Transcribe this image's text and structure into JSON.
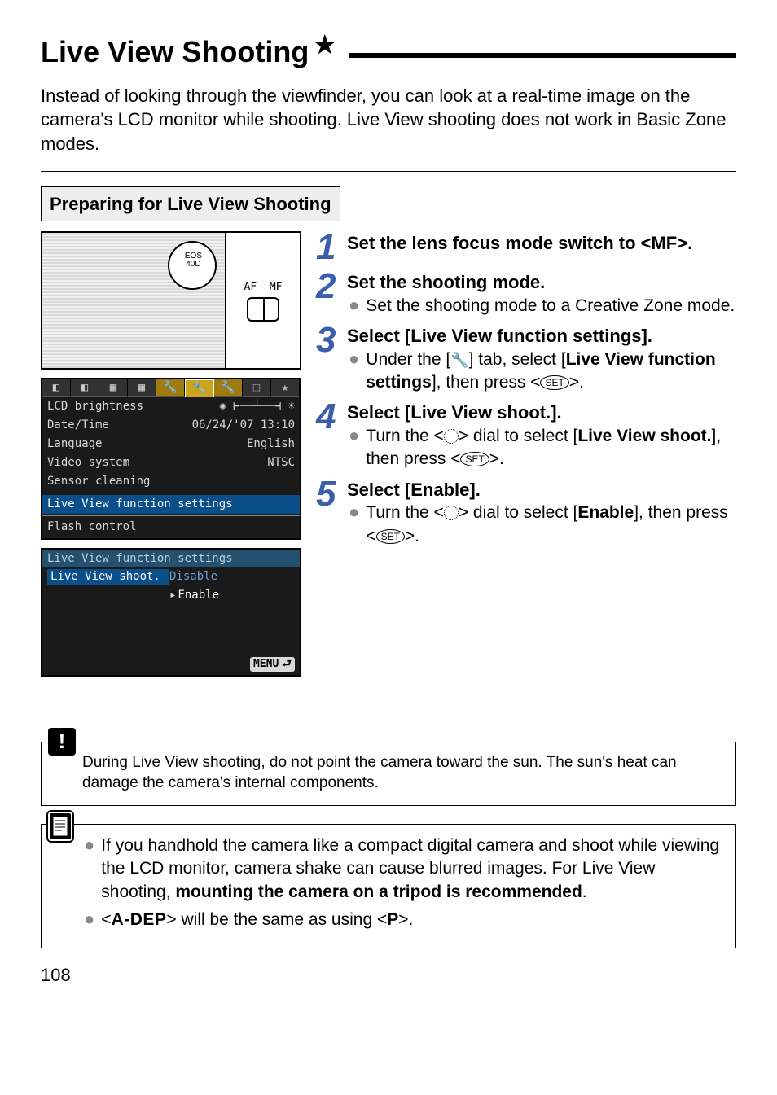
{
  "title": "Live View Shooting",
  "title_star": "★",
  "intro": "Instead of looking through the viewfinder, you can look at a real-time image on the camera's LCD monitor while shooting. Live View shooting does not work in Basic Zone modes.",
  "section_heading": "Preparing for Live View Shooting",
  "camera": {
    "badge_top": "EOS",
    "badge_bottom": "40D",
    "af_label": "AF",
    "mf_label": "MF"
  },
  "lcd1": {
    "rows": [
      {
        "label": "LCD brightness",
        "value": "✺ ⊢──┴──⊣ ☀"
      },
      {
        "label": "Date/Time",
        "value": "06/24/'07 13:10"
      },
      {
        "label": "Language",
        "value": "English"
      },
      {
        "label": "Video system",
        "value": "NTSC"
      },
      {
        "label": "Sensor cleaning",
        "value": ""
      },
      {
        "label": "Live View function settings",
        "value": "",
        "selected": true
      },
      {
        "label": "Flash control",
        "value": ""
      }
    ]
  },
  "lcd2": {
    "title": "Live View function settings",
    "label": "Live View shoot.",
    "opt_disable": "Disable",
    "opt_enable": "Enable",
    "footer": "MENU"
  },
  "steps": [
    {
      "n": "1",
      "title": "Set the lens focus mode switch to <MF>."
    },
    {
      "n": "2",
      "title": "Set the shooting mode.",
      "bullets": [
        "Set the shooting mode to a Creative Zone mode."
      ]
    },
    {
      "n": "3",
      "title": "Select [Live View function settings].",
      "bullets_html": [
        "Under the [<span class='wrench'>🔧</span>] tab, select [<span class='b'>Live View function settings</span>], then press &lt;<span class='set-oval'>SET</span>&gt;."
      ]
    },
    {
      "n": "4",
      "title": "Select [Live View shoot.].",
      "bullets_html": [
        "Turn the &lt;<span class='dial'></span>&gt; dial to select [<span class='b'>Live View shoot.</span>], then press &lt;<span class='set-oval'>SET</span>&gt;."
      ]
    },
    {
      "n": "5",
      "title": "Select [Enable].",
      "bullets_html": [
        "Turn the &lt;<span class='dial'></span>&gt; dial to select [<span class='b'>Enable</span>], then press &lt;<span class='set-oval'>SET</span>&gt;."
      ]
    }
  ],
  "warning": "During Live View shooting, do not point the camera toward the sun. The sun's heat can damage the camera's internal components.",
  "notes": {
    "b1_html": "If you handhold the camera like a compact digital camera and shoot while viewing the LCD monitor, camera shake can cause blurred images. For Live View shooting, <span class='b'>mounting the camera on a tripod is recommended</span>.",
    "b2_html": "&lt;<span class='adep'>A-DEP</span>&gt; will be the same as using &lt;<span class='pmode'>P</span>&gt;."
  },
  "page_number": "108"
}
